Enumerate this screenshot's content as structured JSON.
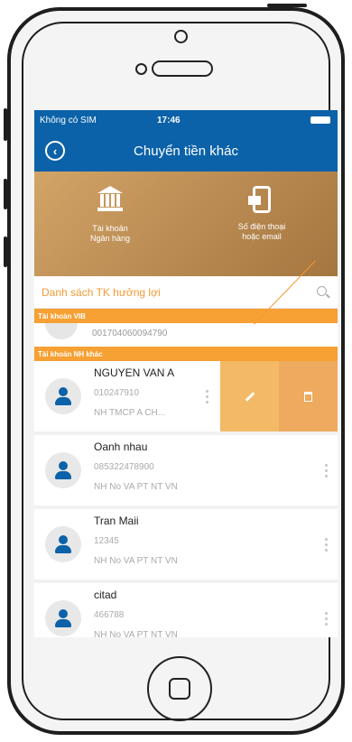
{
  "status_bar": {
    "carrier": "Không có SIM",
    "time": "17:46"
  },
  "header": {
    "title": "Chuyển tiền khác"
  },
  "transfer_options": [
    {
      "label_line1": "Tài khoản",
      "label_line2": "Ngân hàng",
      "icon": "bank-icon"
    },
    {
      "label_line1": "Số điện thoại",
      "label_line2": "hoặc email",
      "icon": "phone-email-icon"
    }
  ],
  "search": {
    "label": "Danh sách TK hưởng lợi"
  },
  "sections": {
    "vib": {
      "title": "Tài khoản VIB",
      "partial_account": "001704060094790"
    },
    "other": {
      "title": "Tài khoản NH khác"
    }
  },
  "beneficiaries": [
    {
      "name": "NGUYEN VAN A",
      "account": "010247910",
      "bank": "NH TMCP A CH..."
    },
    {
      "name": "Oanh nhau",
      "account": "085322478900",
      "bank": "NH No VA PT NT VN"
    },
    {
      "name": "Tran Maii",
      "account": "12345",
      "bank": "NH No VA PT NT VN"
    },
    {
      "name": "citad",
      "account": "466788",
      "bank": "NH No VA PT NT VN"
    }
  ],
  "colors": {
    "primary": "#0b62a8",
    "accent": "#f7a033"
  }
}
